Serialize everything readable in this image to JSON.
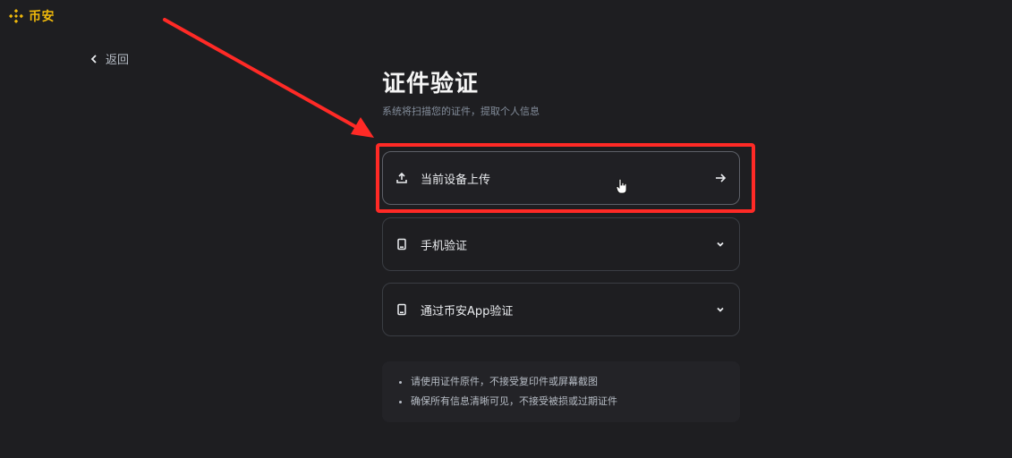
{
  "brand": {
    "name": "币安",
    "accent_color": "#f0b90b",
    "icon": "binance-logo-icon"
  },
  "nav": {
    "back_label": "返回",
    "back_icon": "chevron-left-icon"
  },
  "main": {
    "title": "证件验证",
    "subtitle": "系统将扫描您的证件，提取个人信息"
  },
  "options": [
    {
      "label": "当前设备上传",
      "icon": "upload-icon",
      "trail_icon": "arrow-right-icon"
    },
    {
      "label": "手机验证",
      "icon": "phone-icon",
      "trail_icon": "chevron-down-icon"
    },
    {
      "label": "通过币安App验证",
      "icon": "phone-icon",
      "trail_icon": "chevron-down-icon"
    }
  ],
  "tips": [
    "请使用证件原件，不接受复印件或屏幕截图",
    "确保所有信息清晰可见，不接受被损或过期证件"
  ],
  "annotation": {
    "highlight_color": "#ff2a26"
  }
}
